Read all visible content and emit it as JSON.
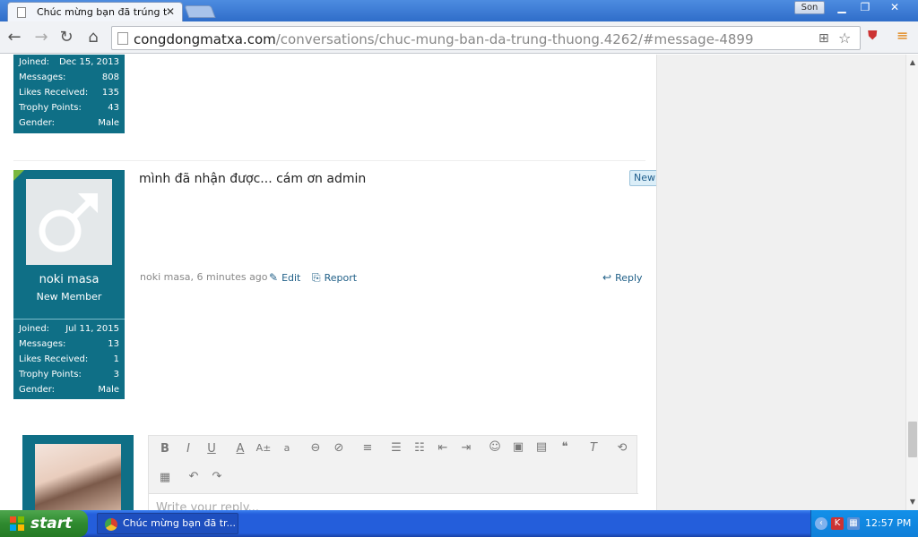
{
  "browser": {
    "tab_title": "Chúc mừng bạn đã trúng thư",
    "url_domain": "congdongmatxa.com",
    "url_path": "/conversations/chuc-mung-ban-da-trung-thuong.4262/#message-4899",
    "profile_name": "Son"
  },
  "prev_user": {
    "stats": [
      {
        "label": "Joined:",
        "value": "Dec 15, 2013"
      },
      {
        "label": "Messages:",
        "value": "808"
      },
      {
        "label": "Likes Received:",
        "value": "135"
      },
      {
        "label": "Trophy Points:",
        "value": "43"
      },
      {
        "label": "Gender:",
        "value": "Male"
      }
    ]
  },
  "message": {
    "text": "mình đã nhận được... cám ơn admin",
    "badge": "New",
    "meta": "noki masa, 6 minutes ago",
    "edit_label": "Edit",
    "report_label": "Report",
    "reply_label": "Reply"
  },
  "user": {
    "name": "noki masa",
    "title": "New Member",
    "stats": [
      {
        "label": "Joined:",
        "value": "Jul 11, 2015"
      },
      {
        "label": "Messages:",
        "value": "13"
      },
      {
        "label": "Likes Received:",
        "value": "1"
      },
      {
        "label": "Trophy Points:",
        "value": "3"
      },
      {
        "label": "Gender:",
        "value": "Male"
      }
    ]
  },
  "editor": {
    "placeholder": "Write your reply..."
  },
  "taskbar": {
    "start_label": "start",
    "task_title": "Chúc mừng bạn đã tr...",
    "clock": "12:57 PM"
  },
  "colors": {
    "user_panel": "#0f6f86",
    "link": "#1f5f87",
    "taskbar": "#245edb"
  }
}
